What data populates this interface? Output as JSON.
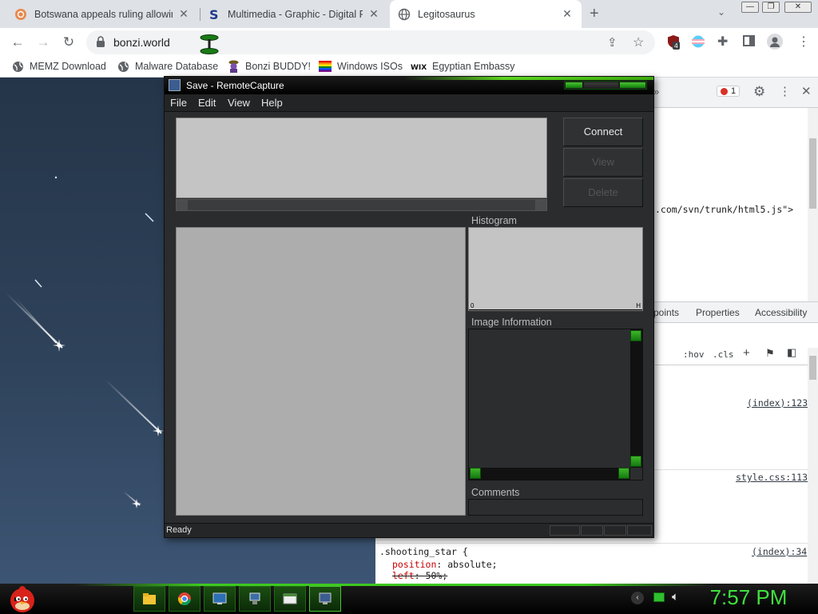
{
  "browser": {
    "tabs": [
      {
        "title": "Botswana appeals ruling allowing",
        "active": false
      },
      {
        "title": "Multimedia - Graphic - Digital Ph",
        "active": false
      },
      {
        "title": "Legitosaurus",
        "active": true
      }
    ],
    "url": "bonzi.world",
    "bookmarks": [
      "MEMZ Download",
      "Malware Database",
      "Bonzi BUDDY!",
      "Windows ISOs",
      "Egyptian Embassy"
    ],
    "extension_badge": "4"
  },
  "devtools": {
    "error_count": "1",
    "source_snippet": ".com/svn/trunk/html5.js\">",
    "tabs": [
      "points",
      "Properties",
      "Accessibility"
    ],
    "filter_toggles": [
      ":hov",
      ".cls"
    ],
    "rule_links": [
      "(index):123",
      "style.css:113",
      "(index):34"
    ],
    "rule_selector": ".shooting_star {",
    "declarations": [
      {
        "prop": "position",
        "value": "absolute;"
      },
      {
        "prop": "left",
        "value": "50%;",
        "struck": true
      }
    ],
    "overflow_chevron": "»"
  },
  "remotecapture": {
    "title": "Save - RemoteCapture",
    "menu": [
      "File",
      "Edit",
      "View",
      "Help"
    ],
    "buttons": {
      "connect": "Connect",
      "view": "View",
      "delete": "Delete"
    },
    "histogram_label": "Histogram",
    "histogram_min": "0",
    "histogram_max": "H",
    "image_info_label": "Image Information",
    "comments_label": "Comments",
    "status": "Ready"
  },
  "taskbar": {
    "clock": "7:57 PM"
  },
  "colors": {
    "accent_green": "#3ee03e",
    "rc_background": "#2a2c2e",
    "panel_gray": "#c4c4c4"
  }
}
